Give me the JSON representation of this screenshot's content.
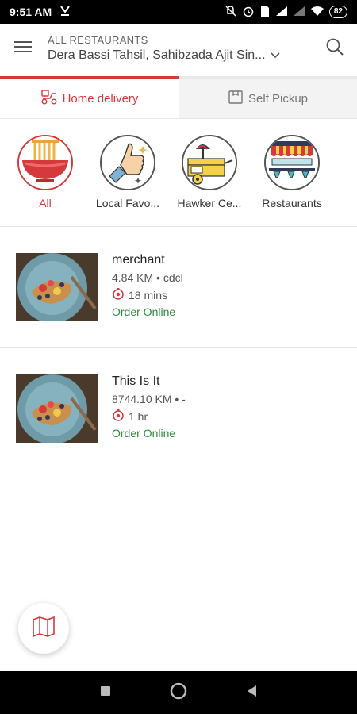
{
  "status_bar": {
    "time": "9:51 AM",
    "battery": "82",
    "icons": [
      "download-icon",
      "mute-icon",
      "alarm-icon",
      "sim-icon",
      "signal-icon",
      "signal-icon",
      "wifi-icon",
      "battery-icon"
    ]
  },
  "header": {
    "label": "ALL RESTAURANTS",
    "location": "Dera Bassi Tahsil, Sahibzada Ajit Sin...",
    "icons": [
      "menu-icon",
      "chevron-down-icon",
      "search-icon"
    ]
  },
  "tabs": [
    {
      "label": "Home delivery",
      "icon": "scooter-icon",
      "active": true
    },
    {
      "label": "Self Pickup",
      "icon": "bag-icon",
      "active": false
    }
  ],
  "categories": [
    {
      "label": "All",
      "icon": "noodle-bowl-icon",
      "active": true
    },
    {
      "label": "Local Favo...",
      "icon": "thumbs-up-icon",
      "active": false
    },
    {
      "label": "Hawker Ce...",
      "icon": "food-cart-icon",
      "active": false
    },
    {
      "label": "Restaurants",
      "icon": "storefront-icon",
      "active": false
    }
  ],
  "restaurants": [
    {
      "name": "merchant",
      "meta": "4.84 KM • cdcl",
      "eta": "18 mins",
      "status": "Order Online"
    },
    {
      "name": "This Is It",
      "meta": "8744.10 KM • -",
      "eta": "1 hr",
      "status": "Order Online"
    }
  ],
  "fab": {
    "icon": "map-icon"
  },
  "nav": {
    "icons": [
      "recents-icon",
      "home-icon",
      "back-icon"
    ]
  },
  "colors": {
    "accent": "#d6393c",
    "success": "#2e8b3a"
  }
}
